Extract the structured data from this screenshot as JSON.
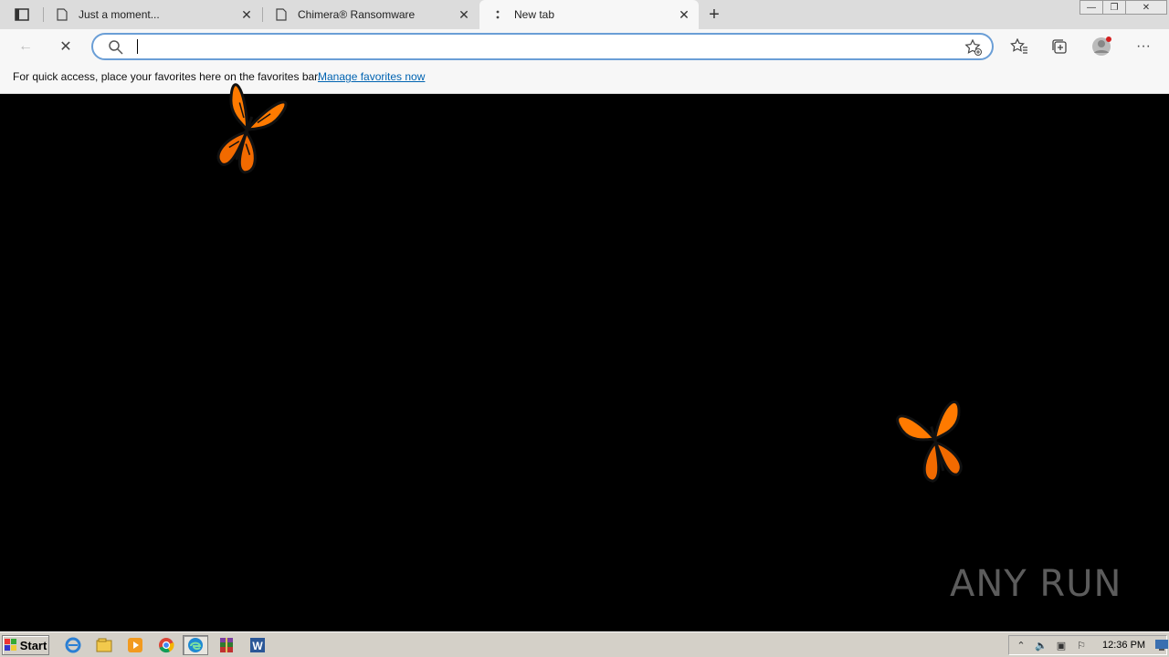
{
  "browser": {
    "tabs": [
      {
        "title": "Just a moment...",
        "active": false
      },
      {
        "title": "Chimera® Ransomware",
        "active": false
      },
      {
        "title": "New tab",
        "active": true
      }
    ],
    "address_value": "",
    "favorites_bar": {
      "message": "For quick access, place your favorites here on the favorites bar.",
      "link": "Manage favorites now"
    }
  },
  "content": {
    "background": "#000000",
    "butterfly_color": "#ff7a00"
  },
  "watermark": {
    "text": "ANY RUN"
  },
  "taskbar": {
    "start_label": "Start",
    "apps": [
      "internet-explorer-icon",
      "file-explorer-icon",
      "media-player-icon",
      "chrome-icon",
      "edge-icon",
      "winrar-icon",
      "word-icon"
    ],
    "clock": "12:36 PM"
  }
}
